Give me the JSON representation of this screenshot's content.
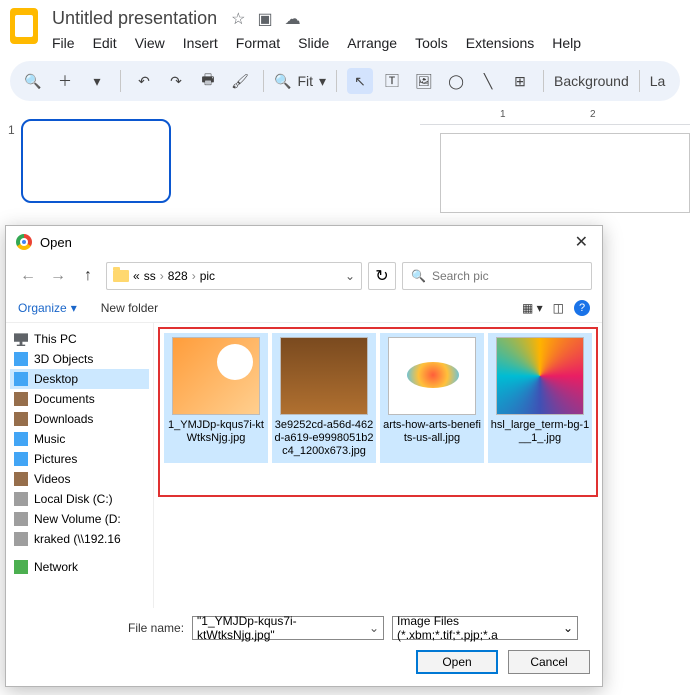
{
  "doc": {
    "title": "Untitled presentation"
  },
  "menubar": [
    "File",
    "Edit",
    "View",
    "Insert",
    "Format",
    "Slide",
    "Arrange",
    "Tools",
    "Extensions",
    "Help"
  ],
  "toolbar": {
    "zoom": "Fit",
    "background": "Background",
    "layout": "La"
  },
  "ruler": {
    "t1": "1",
    "t2": "2"
  },
  "thumb": {
    "num": "1"
  },
  "dialog": {
    "title": "Open",
    "breadcrumb": {
      "root": "«",
      "p1": "ss",
      "p2": "828",
      "p3": "pic"
    },
    "search_placeholder": "Search pic",
    "organize": "Organize",
    "newfolder": "New folder",
    "tree": {
      "thispc": "This PC",
      "objects3d": "3D Objects",
      "desktop": "Desktop",
      "documents": "Documents",
      "downloads": "Downloads",
      "music": "Music",
      "pictures": "Pictures",
      "videos": "Videos",
      "localc": "Local Disk (C:)",
      "newvol": "New Volume (D:",
      "kraked": "kraked (\\\\192.16",
      "network": "Network"
    },
    "files": [
      {
        "name": "1_YMJDp-kqus7i-ktWtksNjg.jpg"
      },
      {
        "name": "3e9252cd-a56d-462d-a619-e999805​1b2c4_1200x673.jpg"
      },
      {
        "name": "arts-how-arts-benefits-us-all.jpg"
      },
      {
        "name": "hsl_large_term-bg-1__1_.jpg"
      }
    ],
    "footer": {
      "fn_label": "File name:",
      "fn_value": "\"1_YMJDp-kqus7i-ktWtksNjg.jpg\"",
      "filter": "Image Files (*.xbm;*.tif;*.pjp;*.a",
      "open": "Open",
      "cancel": "Cancel"
    }
  }
}
